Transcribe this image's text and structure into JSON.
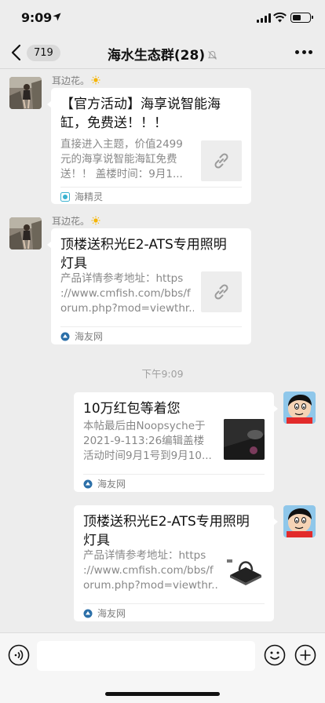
{
  "status_bar": {
    "time": "9:09"
  },
  "nav": {
    "unread_count": "719",
    "title": "海水生态群(28)"
  },
  "messages": [
    {
      "sender": "耳边花。",
      "title_line1": "【官方活动】海享说智能海",
      "title_line2": "缸，免费送！！！",
      "desc_line1": "直接进入主题，价值2499",
      "desc_line2": "元的海享说智能海缸免费",
      "desc_line3": "送！！ 盖楼时间：9月1...",
      "source": "海精灵"
    },
    {
      "sender": "耳边花。",
      "title_line1": "顶楼送积光E2-ATS专用照明",
      "title_line2": "灯具",
      "desc_line1": "产品详情参考地址：https",
      "desc_line2": "://www.cmfish.com/bbs/f",
      "desc_line3": "orum.php?mod=viewthr...",
      "source": "海友网"
    },
    {
      "title_line1": "10万红包等着您",
      "desc_line1": "本帖最后由Noopsyche于",
      "desc_line2": "2021-9-113:26编辑盖楼",
      "desc_line3": "活动时间9月1号到9月10...",
      "source": "海友网"
    },
    {
      "title_line1": "顶楼送积光E2-ATS专用照明",
      "title_line2": "灯具",
      "desc_line1": "产品详情参考地址：https",
      "desc_line2": "://www.cmfish.com/bbs/f",
      "desc_line3": "orum.php?mod=viewthr...",
      "source": "海友网"
    }
  ],
  "timestamp": "下午9:09",
  "input": {
    "value": ""
  },
  "colors": {
    "background": "#ededed",
    "bubble": "#ffffff",
    "secondary_text": "#888888"
  }
}
